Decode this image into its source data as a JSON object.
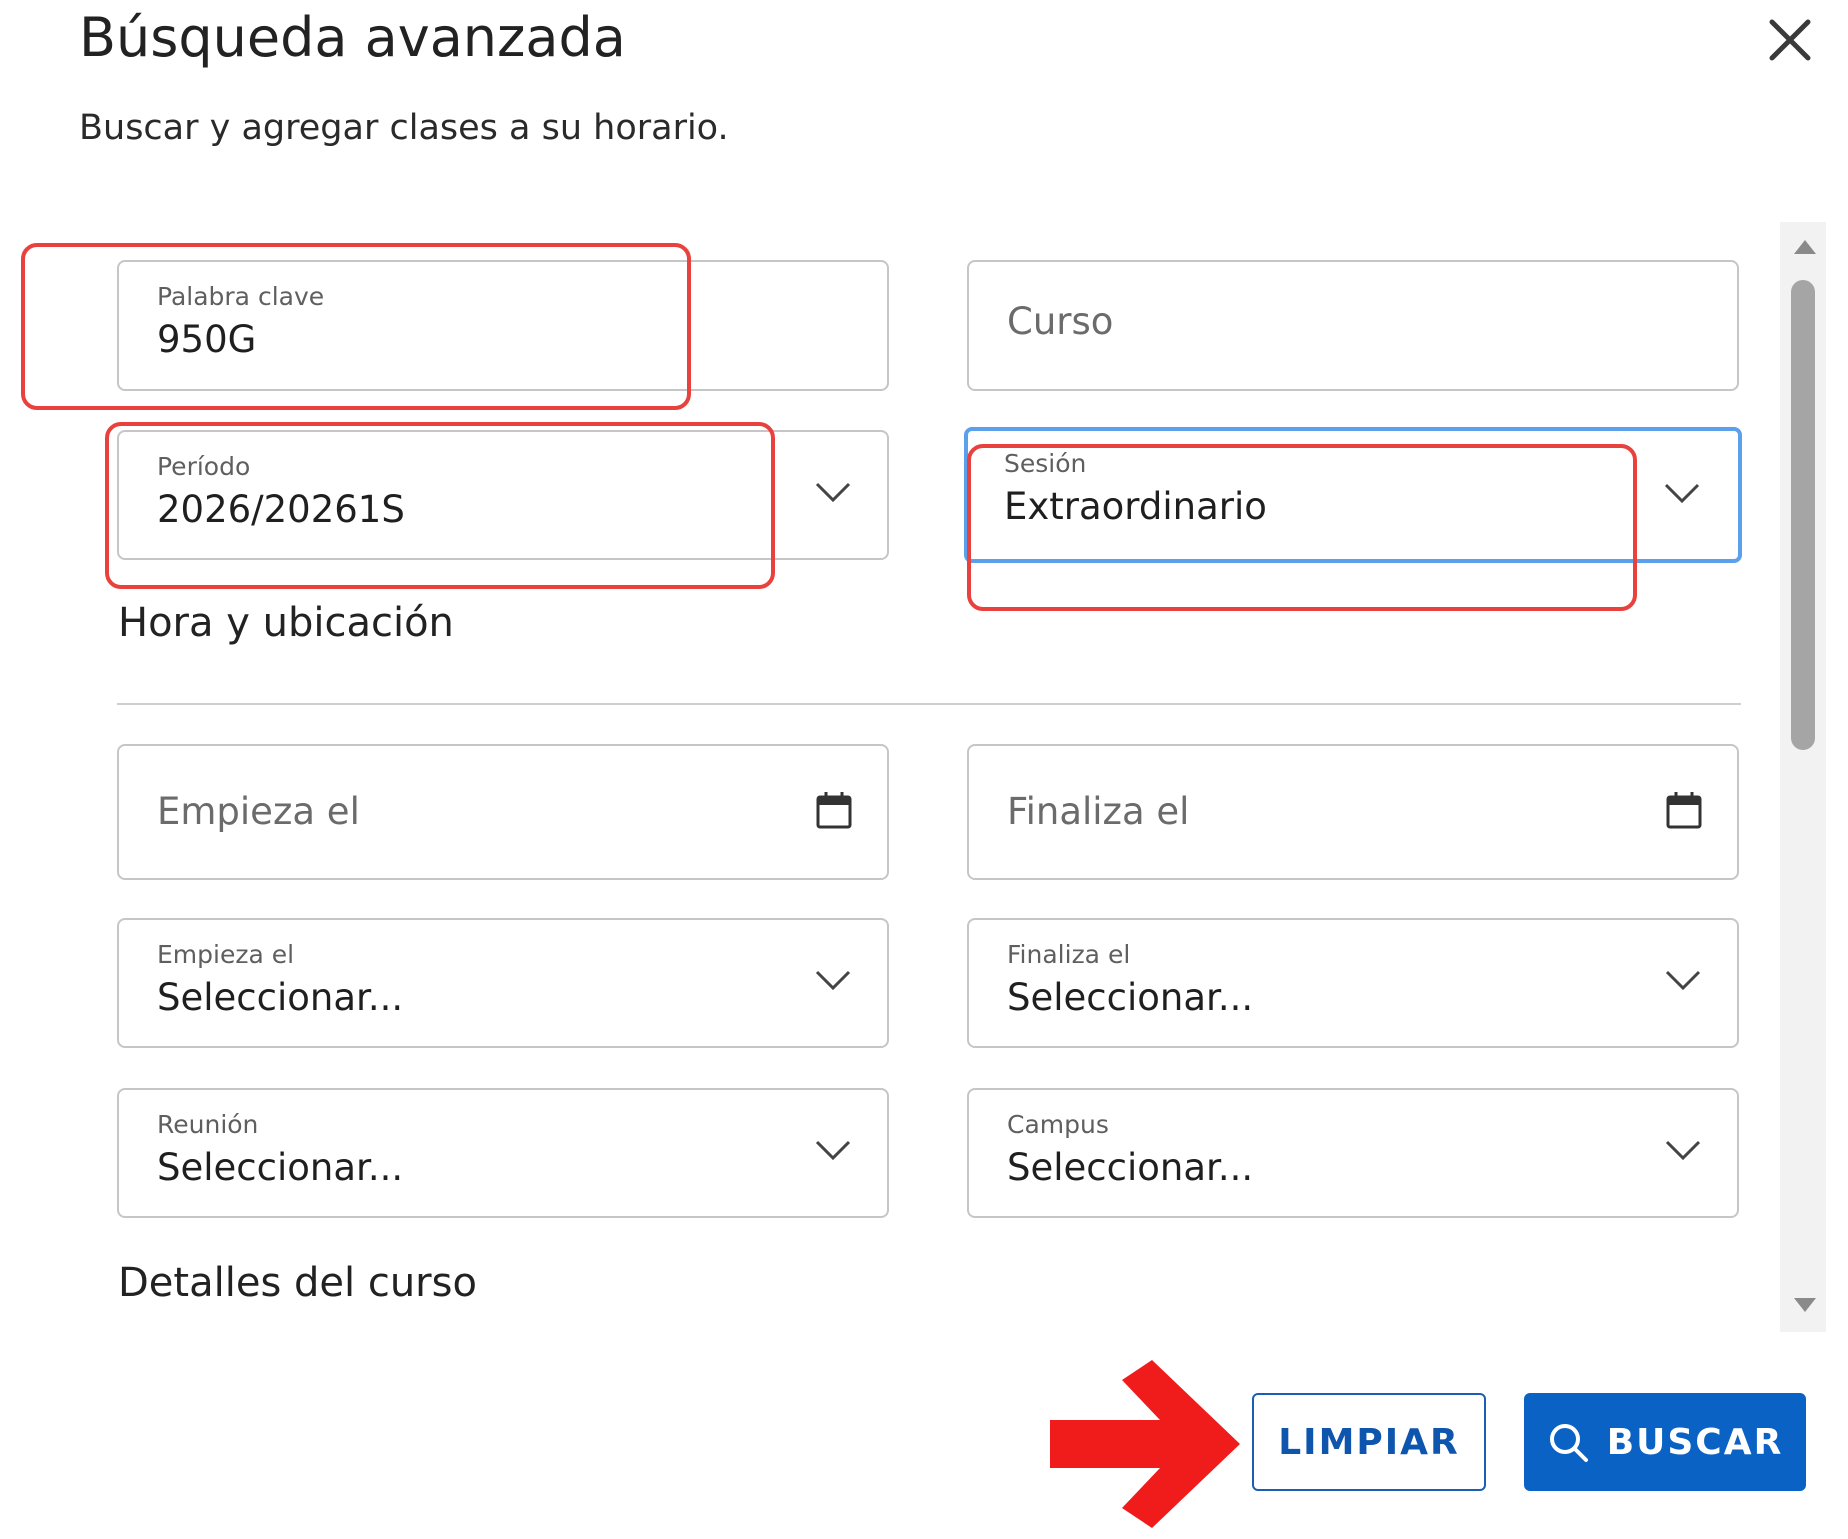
{
  "dialog": {
    "title": "Búsqueda avanzada",
    "subtitle": "Buscar y agregar clases a su horario.",
    "close_icon": "close-icon"
  },
  "fields": {
    "keyword": {
      "label": "Palabra clave",
      "value": "950G"
    },
    "course": {
      "placeholder": "Curso"
    },
    "period": {
      "label": "Período",
      "value": "2026/20261S"
    },
    "session": {
      "label": "Sesión",
      "value": "Extraordinario"
    },
    "start_date": {
      "placeholder": "Empieza el"
    },
    "end_date": {
      "placeholder": "Finaliza el"
    },
    "start_time": {
      "label": "Empieza el",
      "value": "Seleccionar..."
    },
    "end_time": {
      "label": "Finaliza el",
      "value": "Seleccionar..."
    },
    "meeting": {
      "label": "Reunión",
      "value": "Seleccionar..."
    },
    "campus": {
      "label": "Campus",
      "value": "Seleccionar..."
    }
  },
  "sections": {
    "time_location": "Hora y ubicación",
    "course_details": "Detalles del curso"
  },
  "buttons": {
    "clear": "LIMPIAR",
    "search": "BUSCAR"
  },
  "colors": {
    "primary": "#0a62c4",
    "focus_border": "#5aa0ea",
    "annotation": "#e8413e",
    "arrow": "#f01c1c"
  }
}
